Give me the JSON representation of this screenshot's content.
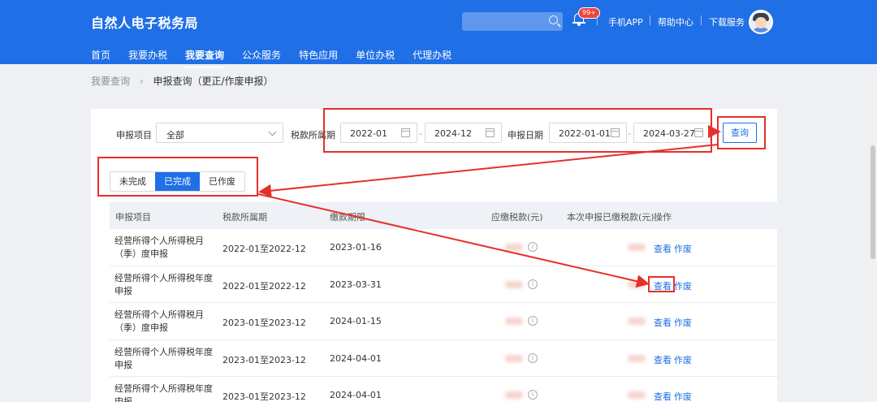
{
  "header": {
    "logo": "自然人电子税务局",
    "badge": "99+",
    "links": [
      "手机APP",
      "帮助中心",
      "下载服务"
    ]
  },
  "nav": [
    "首页",
    "我要办税",
    "我要查询",
    "公众服务",
    "特色应用",
    "单位办税",
    "代理办税"
  ],
  "nav_active_index": 2,
  "breadcrumb": {
    "parent": "我要查询",
    "current": "申报查询（更正/作废申报）"
  },
  "filters": {
    "project_label": "申报项目",
    "project_value": "全部",
    "period_label": "税款所属期",
    "period_start": "2022-01",
    "period_end": "2024-12",
    "date_label": "申报日期",
    "date_start": "2022-01-01",
    "date_end": "2024-03-27",
    "query_button": "查询"
  },
  "tabs": [
    "未完成",
    "已完成",
    "已作废"
  ],
  "tab_active_index": 1,
  "table": {
    "headers": [
      "申报项目",
      "税款所属期",
      "缴款期限",
      "应缴税款(元)",
      "本次申报已缴税款(元)",
      "操作"
    ],
    "rows": [
      {
        "name": "经营所得个人所得税月（季）度申报",
        "period": "2022-01至2022-12",
        "deadline": "2023-01-16"
      },
      {
        "name": "经营所得个人所得税年度申报",
        "period": "2022-01至2022-12",
        "deadline": "2023-03-31"
      },
      {
        "name": "经营所得个人所得税月（季）度申报",
        "period": "2023-01至2023-12",
        "deadline": "2024-01-15"
      },
      {
        "name": "经营所得个人所得税年度申报",
        "period": "2023-01至2023-12",
        "deadline": "2024-04-01"
      },
      {
        "name": "经营所得个人所得税年度申报",
        "period": "2023-01至2023-12",
        "deadline": "2024-04-01"
      }
    ],
    "action_view": "查看",
    "action_void": "作废",
    "info_glyph": "i"
  },
  "colors": {
    "header": "#1f6fe6",
    "annotation": "#e5302b"
  }
}
